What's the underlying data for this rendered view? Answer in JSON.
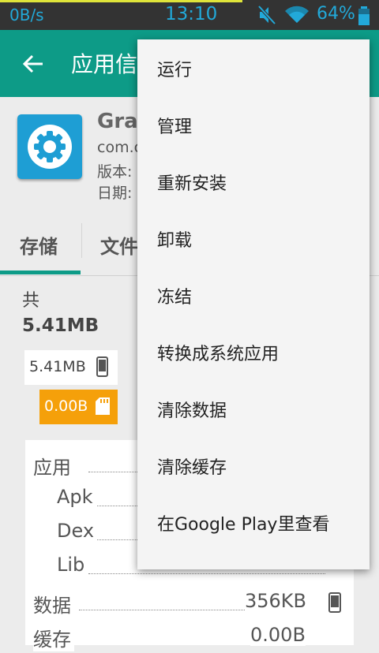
{
  "status_bar": {
    "net_speed": "0B/s",
    "time": "13:10",
    "battery_percent": "64%",
    "download_progress": 0.64,
    "icons": [
      "mute-icon",
      "wifi-icon",
      "battery-icon"
    ]
  },
  "toolbar": {
    "back_icon": "arrow-left-icon",
    "title": "应用信"
  },
  "app": {
    "name": "Grav",
    "package": "com.c",
    "version_label": "版本:",
    "date_label": "日期:",
    "icon": "gear-icon",
    "icon_color": "#1e9ed4"
  },
  "tabs": [
    {
      "label": "存储",
      "selected": true
    },
    {
      "label": "文件",
      "selected": false
    }
  ],
  "storage": {
    "total_label": "共",
    "total_value": "5.41MB",
    "phone_chip": {
      "value": "5.41MB",
      "icon": "phone-icon"
    },
    "sd_chip": {
      "value": "0.00B",
      "icon": "sd-card-icon",
      "color": "#f5a00a"
    },
    "breakdown": [
      {
        "label": "应用",
        "value": "",
        "indent": false
      },
      {
        "label": "Apk",
        "value": "",
        "indent": true
      },
      {
        "label": "Dex",
        "value": "",
        "indent": true
      },
      {
        "label": "Lib",
        "value": "",
        "indent": true
      },
      {
        "label": "数据",
        "value": "356KB",
        "indent": false,
        "icon": "phone-icon"
      },
      {
        "label": "缓存",
        "value": "0.00B",
        "indent": false
      }
    ]
  },
  "menu": {
    "items": [
      "运行",
      "管理",
      "重新安装",
      "卸载",
      "冻结",
      "转换成系统应用",
      "清除数据",
      "清除缓存",
      "在Google Play里查看"
    ]
  },
  "colors": {
    "accent": "#0d9b87",
    "status_text": "#22a9d9",
    "sd_orange": "#f5a00a"
  }
}
